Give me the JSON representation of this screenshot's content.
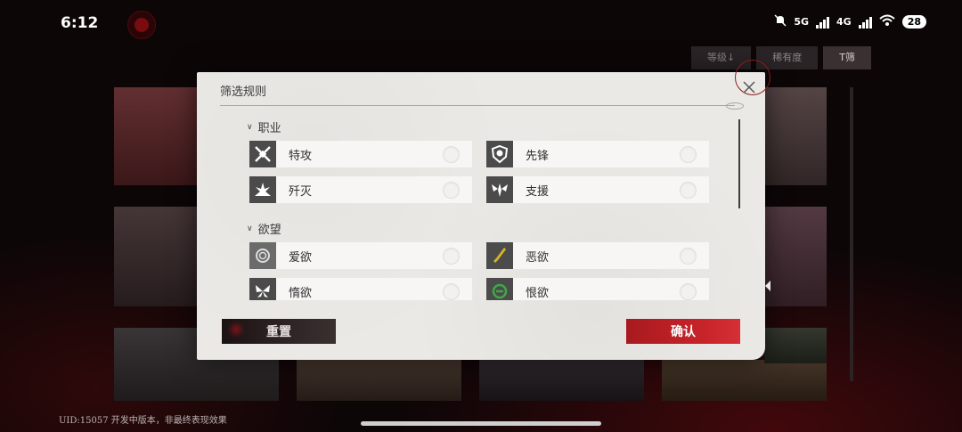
{
  "status_bar": {
    "time": "6:12",
    "network_5g": "5G",
    "network_4g": "4G",
    "battery": "28",
    "icons": [
      "mute-icon",
      "signal-icon",
      "wifi-icon",
      "battery-icon"
    ]
  },
  "background": {
    "tabs": [
      "等级↓",
      "稀有度",
      "T筛"
    ],
    "uid_notice": "UID:15057   开发中版本，非最终表现效果"
  },
  "filter_modal": {
    "title": "筛选规则",
    "groups": [
      {
        "label": "职业",
        "options": [
          {
            "label": "特攻",
            "icon": "crossed-blades-icon",
            "selected": false
          },
          {
            "label": "先锋",
            "icon": "helmet-shield-icon",
            "selected": false
          },
          {
            "label": "歼灭",
            "icon": "explosion-icon",
            "selected": false
          },
          {
            "label": "支援",
            "icon": "winged-star-icon",
            "selected": false
          }
        ]
      },
      {
        "label": "欲望",
        "options": [
          {
            "label": "爱欲",
            "icon": "rose-icon",
            "selected": false
          },
          {
            "label": "恶欲",
            "icon": "dagger-icon",
            "selected": false
          },
          {
            "label": "惰欲",
            "icon": "butterfly-icon",
            "selected": false
          },
          {
            "label": "恨欲",
            "icon": "serpent-icon",
            "selected": false
          }
        ]
      }
    ],
    "reset_label": "重置",
    "confirm_label": "确认"
  },
  "colors": {
    "modal_bg": "#ebe9e5",
    "confirm_red": "#c8242a",
    "reset_dark": "#2a1f20",
    "icon_tile": "#4b4b4b",
    "green_accent": "#3fa84a",
    "gold_accent": "#d6b32b"
  }
}
